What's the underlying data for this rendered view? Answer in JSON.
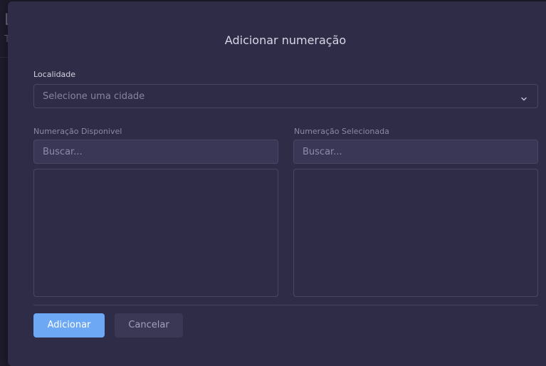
{
  "background": {
    "heading": "L",
    "subtext": "T"
  },
  "modal": {
    "title": "Adicionar numeração",
    "locality": {
      "label": "Localidade",
      "placeholder": "Selecione uma cidade",
      "icon": "chevron-down-icon"
    },
    "available": {
      "label": "Numeração Disponivel",
      "search_placeholder": "Buscar...",
      "items": []
    },
    "selected": {
      "label": "Numeração Selecionada",
      "search_placeholder": "Buscar...",
      "items": []
    },
    "buttons": {
      "add": "Adicionar",
      "cancel": "Cancelar"
    }
  },
  "colors": {
    "modal_bg": "#2f2c47",
    "primary": "#6ca8f4",
    "secondary_btn": "#3b3855"
  }
}
